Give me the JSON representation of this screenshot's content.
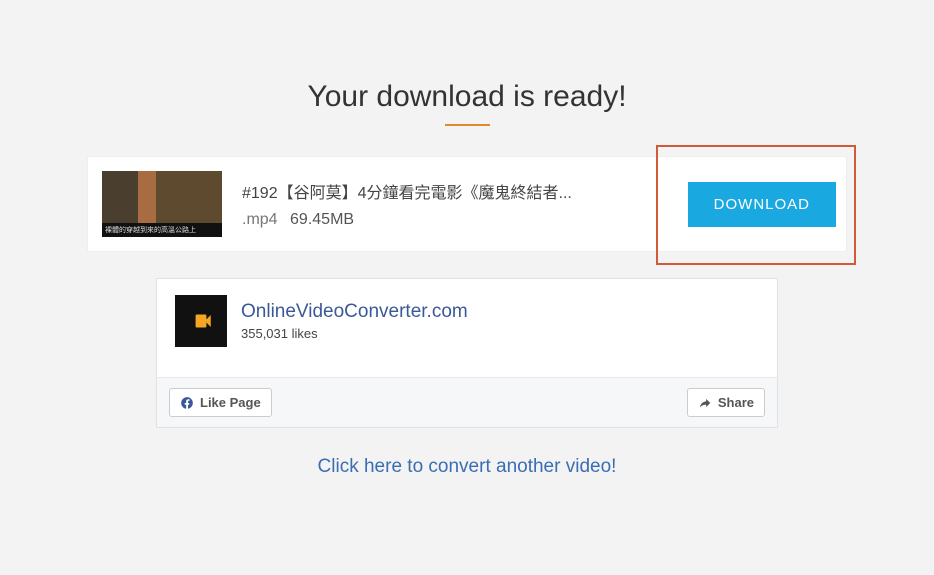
{
  "heading": "Your download is ready!",
  "video": {
    "title": "#192【谷阿莫】4分鐘看完電影《魔鬼終結者...",
    "ext": ".mp4",
    "size": "69.45MB",
    "download_label": "DOWNLOAD",
    "thumb_caption": "裸體的穿越到來的高溫公路上"
  },
  "facebook": {
    "page_name": "OnlineVideoConverter.com",
    "likes_text": "355,031 likes",
    "like_label": "Like Page",
    "share_label": "Share"
  },
  "convert_link": "Click here to convert another video!"
}
